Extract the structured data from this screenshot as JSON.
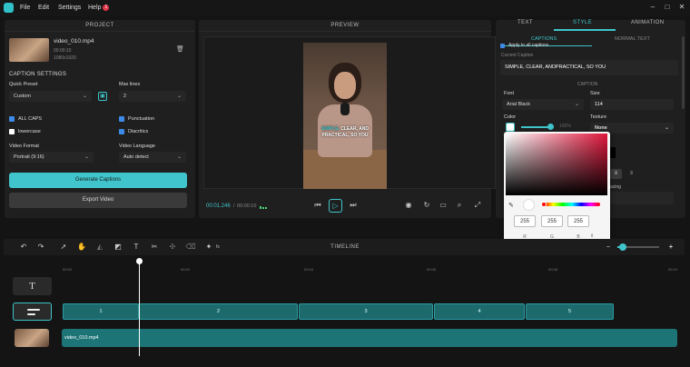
{
  "menu": {
    "items": [
      "File",
      "Edit",
      "Settings",
      "Help"
    ],
    "help_badge": "1"
  },
  "window_controls": {
    "minimize": "–",
    "maximize": "□",
    "close": "✕"
  },
  "project": {
    "title": "PROJECT",
    "file_name": "video_010.mp4",
    "duration": "00:00:10",
    "resolution": "1080x1920",
    "caption_settings": "CAPTION SETTINGS",
    "quick_preset_label": "Quick Preset",
    "quick_preset_value": "Custom",
    "max_lines_label": "Max lines",
    "max_lines_value": "2",
    "all_caps": "ALL CAPS",
    "punctuation": "Punctuation",
    "lowercase": "lowercase",
    "diacritics": "Diacritics",
    "video_format_label": "Video Format",
    "video_format_value": "Portrait (9:16)",
    "video_language_label": "Video Language",
    "video_language_value": "Auto detect",
    "generate_button": "Generate Captions",
    "export_button": "Export Video"
  },
  "preview": {
    "title": "PREVIEW",
    "current_time": "00:01.246",
    "total_time": "00:00:10",
    "caption_line1_highlight": "SIMPLE,",
    "caption_line1_rest": " CLEAR, AND",
    "caption_line2": "PRACTICAL, SO YOU"
  },
  "style_panel": {
    "tabs": [
      "TEXT",
      "STYLE",
      "ANIMATION"
    ],
    "active_tab": "STYLE",
    "subtabs": [
      "CAPTIONS",
      "NORMAL TEXT"
    ],
    "apply_all": "Apply to all captions",
    "current_caption_label": "Current Caption",
    "current_caption_value": "SIMPLE, CLEAR, ANDPRACTICAL, SO YOU",
    "caption_section": "CAPTION",
    "font_label": "Font",
    "font_value": "Arial Black",
    "size_label": "Size",
    "size_value": "114",
    "color_label": "Color",
    "opacity_value": "100%",
    "texture_label": "Texture",
    "texture_value": "None",
    "spacing_label": "acing"
  },
  "color_picker": {
    "r": "255",
    "g": "255",
    "b": "255",
    "r_label": "R",
    "g_label": "G",
    "b_label": "B",
    "mode_toggle": "⇕"
  },
  "timeline": {
    "title": "TIMELINE",
    "zoom_label": "fx",
    "ticks": [
      "00:00",
      "00:02",
      "00:04",
      "00:06",
      "00:08",
      "00:10"
    ],
    "caption_segments": [
      "1",
      "2",
      "3",
      "4",
      "5"
    ],
    "video_clip_label": "video_010.mp4"
  },
  "colors": {
    "accent": "#3fc5cb",
    "checkbox": "#3d8be8",
    "clip": "#1d7477",
    "picker_hue": "#e0163b"
  }
}
